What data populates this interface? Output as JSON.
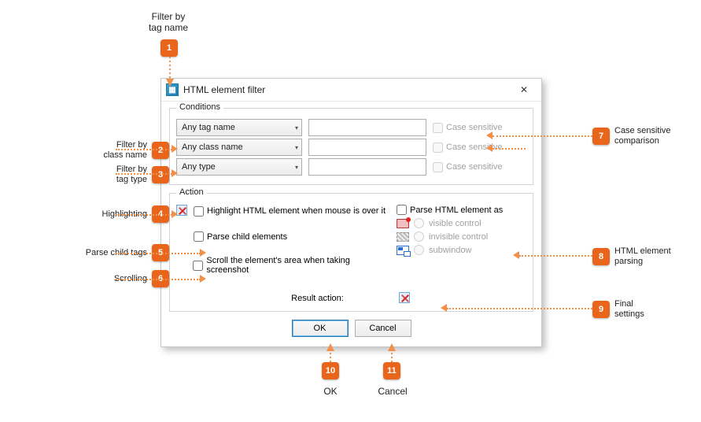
{
  "dialog": {
    "title": "HTML element filter",
    "conditions": {
      "legend": "Conditions",
      "rows": [
        {
          "select": "Any tag name",
          "value": "",
          "case": "Case sensitive"
        },
        {
          "select": "Any class name",
          "value": "",
          "case": "Case sensitive"
        },
        {
          "select": "Any type",
          "value": "",
          "case": "Case sensitive"
        }
      ]
    },
    "action": {
      "legend": "Action",
      "highlight": "Highlight HTML element when mouse is over it",
      "parseChild": "Parse child elements",
      "scroll": "Scroll the element's area when taking screenshot",
      "parseAs": "Parse HTML element as",
      "radios": [
        "visible control",
        "invisible control",
        "subwindow"
      ],
      "result_label": "Result action:"
    },
    "buttons": {
      "ok": "OK",
      "cancel": "Cancel"
    }
  },
  "annotations": {
    "1": {
      "num": "1",
      "label": "Filter by\ntag name"
    },
    "2": {
      "num": "2",
      "label": "Filter by\nclass name"
    },
    "3": {
      "num": "3",
      "label": "Filter by\ntag type"
    },
    "4": {
      "num": "4",
      "label": "Highlighting"
    },
    "5": {
      "num": "5",
      "label": "Parse child tags"
    },
    "6": {
      "num": "6",
      "label": "Scrolling"
    },
    "7": {
      "num": "7",
      "label": "Case sensitive\ncomparison"
    },
    "8": {
      "num": "8",
      "label": "HTML element\nparsing"
    },
    "9": {
      "num": "9",
      "label": "Final\nsettings"
    },
    "10": {
      "num": "10",
      "label": "OK"
    },
    "11": {
      "num": "11",
      "label": "Cancel"
    }
  }
}
